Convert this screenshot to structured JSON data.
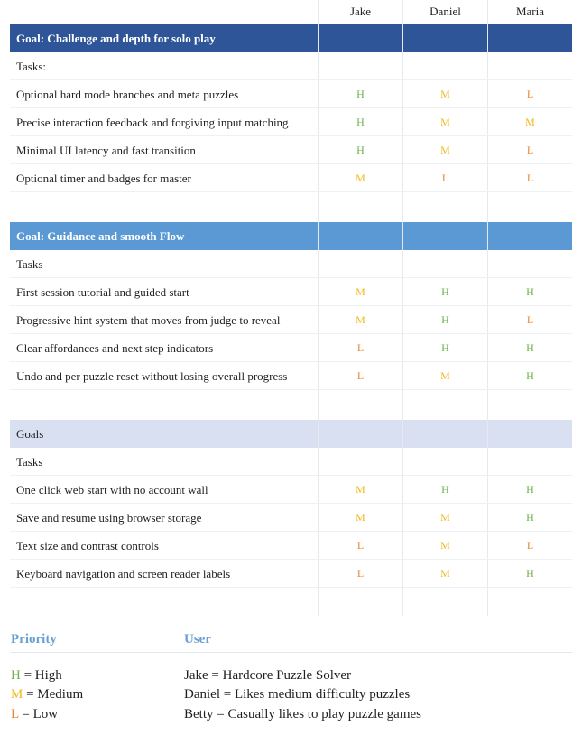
{
  "header": {
    "col1": "Jake",
    "col2": "Daniel",
    "col3": "Maria"
  },
  "colors": {
    "H": "#6ab04c",
    "M": "#f1b81c",
    "L": "#e8872f"
  },
  "sections": [
    {
      "goal": "Goal: Challenge and depth for solo play",
      "style": "dark",
      "tasks_label": "Tasks:",
      "rows": [
        {
          "task": "Optional hard mode branches and meta puzzles",
          "p": [
            "H",
            "M",
            "L"
          ]
        },
        {
          "task": "Precise interaction feedback and forgiving input matching",
          "p": [
            "H",
            "M",
            "M"
          ]
        },
        {
          "task": "Minimal UI latency and fast transition",
          "p": [
            "H",
            "M",
            "L"
          ]
        },
        {
          "task": "Optional timer and badges for master",
          "p": [
            "M",
            "L",
            "L"
          ]
        }
      ]
    },
    {
      "goal": "Goal: Guidance and smooth Flow",
      "style": "mid",
      "tasks_label": "Tasks",
      "rows": [
        {
          "task": "First session tutorial and guided start",
          "p": [
            "M",
            "H",
            "H"
          ]
        },
        {
          "task": "Progressive hint system that moves from judge to reveal",
          "p": [
            "M",
            "H",
            "L"
          ]
        },
        {
          "task": "Clear affordances and next step indicators",
          "p": [
            "L",
            "H",
            "H"
          ]
        },
        {
          "task": "Undo and per puzzle reset without losing overall progress",
          "p": [
            "L",
            "M",
            "H"
          ]
        }
      ]
    },
    {
      "goal": "Goals",
      "style": "light",
      "tasks_label": "Tasks",
      "rows": [
        {
          "task": "One click web start with no account wall",
          "p": [
            "M",
            "H",
            "H"
          ]
        },
        {
          "task": "Save and resume using browser storage",
          "p": [
            "M",
            "M",
            "H"
          ]
        },
        {
          "task": "Text size and contrast controls",
          "p": [
            "L",
            "M",
            "L"
          ]
        },
        {
          "task": "Keyboard navigation and screen reader labels",
          "p": [
            "L",
            "M",
            "H"
          ]
        }
      ]
    }
  ],
  "legend": {
    "priority_title": "Priority",
    "user_title": "User",
    "priority_items": [
      {
        "key": "H",
        "text": " = High"
      },
      {
        "key": "M",
        "text": " = Medium"
      },
      {
        "key": "L",
        "text": " = Low"
      }
    ],
    "user_items": [
      "Jake = Hardcore Puzzle Solver",
      "Daniel = Likes medium difficulty puzzles",
      "Betty = Casually likes to play puzzle games"
    ]
  }
}
